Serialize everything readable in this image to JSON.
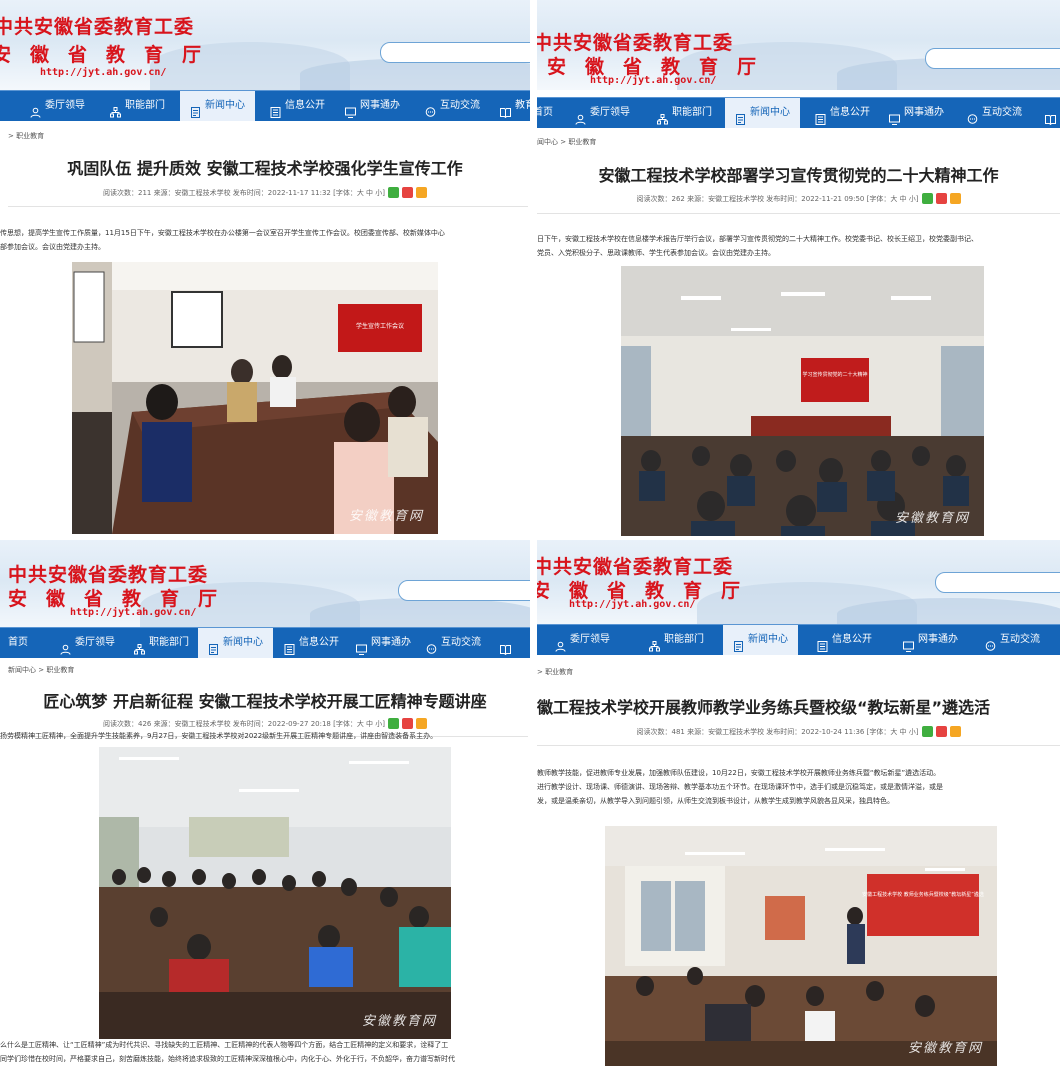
{
  "site": {
    "org_name": "中共安徽省委教育工委",
    "dept_name": "安徽省教育厅",
    "url": "http://jyt.ah.gov.cn/",
    "nav": [
      "首页",
      "委厅领导",
      "职能部门",
      "新闻中心",
      "信息公开",
      "网事通办",
      "互动交流",
      "教育"
    ],
    "active_nav": "新闻中心",
    "share_icons": [
      "wechat-icon",
      "weibo-icon",
      "qzone-icon"
    ],
    "colors": {
      "brand_red": "#d8141c",
      "nav_blue": "#1565b8"
    }
  },
  "articles": [
    {
      "breadcrumb": "> 职业教育",
      "title": "巩固队伍 提升质效 安徽工程技术学校强化学生宣传工作",
      "meta": "阅读次数：211  来源：安徽工程技术学校  发布时间：2022-11-17 11:32  [字体：大 中 小]",
      "body": [
        "传思想，提高学生宣传工作质量，11月15日下午，安徽工程技术学校在办公楼第一会议室召开学生宣传工作会议。校团委宣传部、校新媒体中心",
        "部参加会议。会议由党建办主持。"
      ],
      "photo_text": "学生宣传工作会议",
      "watermark": "安徽教育网"
    },
    {
      "breadcrumb": "闻中心 > 职业教育",
      "title": "安徽工程技术学校部署学习宣传贯彻党的二十大精神工作",
      "meta": "阅读次数：262  来源：安徽工程技术学校  发布时间：2022-11-21 09:50  [字体：大 中 小]",
      "body": [
        "日下午，安徽工程技术学校在信息楼学术报告厅举行会议，部署学习宣传贯彻党的二十大精神工作。校党委书记、校长王绍卫，校党委副书记、",
        "党员、入党积极分子、思政课教师、学生代表参加会议。会议由党建办主持。"
      ],
      "photo_text": "学习宣传贯彻党的二十大精神",
      "watermark": "安徽教育网"
    },
    {
      "breadcrumb": "新闻中心 > 职业教育",
      "title": "匠心筑梦 开启新征程 安徽工程技术学校开展工匠精神专题讲座",
      "meta": "阅读次数：426  来源：安徽工程技术学校  发布时间：2022-09-27 20:18  [字体：大 中 小]",
      "body": [
        "扬劳模精神工匠精神，全面提升学生技能素养，9月27日，安徽工程技术学校对2022级新生开展工匠精神专题讲座，讲座由智造装备系主办。"
      ],
      "body_bottom": [
        "么什么是工匠精神、让“工匠精神”成为时代共识、寻找缺失的工匠精神、工匠精神的代表人物等四个方面，结合工匠精神的定义和要求，诠释了工",
        "同学们珍惜在校时间，严格要求自己，刻苦磨炼技能，始终将追求极致的工匠精神深深植根心中，内化于心、外化于行，不负韶华，奋力谱写新时代"
      ],
      "watermark": "安徽教育网"
    },
    {
      "breadcrumb": "> 职业教育",
      "title": "徽工程技术学校开展教师教学业务练兵暨校级“教坛新星”遴选活",
      "meta": "阅读次数：481  来源：安徽工程技术学校  发布时间：2022-10-24 11:36  [字体：大 中 小]",
      "body": [
        "教师教学技能，促进教师专业发展，加强教师队伍建设，10月22日，安徽工程技术学校开展教师业务练兵暨“教坛新星”遴选活动。",
        "进行教学设计、现场课、师德演讲、现场答辩、教学基本功五个环节。在现场课环节中，选手们或是沉稳笃定，或是激情洋溢，或是",
        "发，或是温柔亲切，从教学导入到问题引领，从师生交流到板书设计，从教学生成到教学风貌各显风采，独具特色。"
      ],
      "photo_text": "安徽工程技术学校 教师业务练兵暨校级“教坛新星”遴选",
      "watermark": "安徽教育网"
    }
  ]
}
